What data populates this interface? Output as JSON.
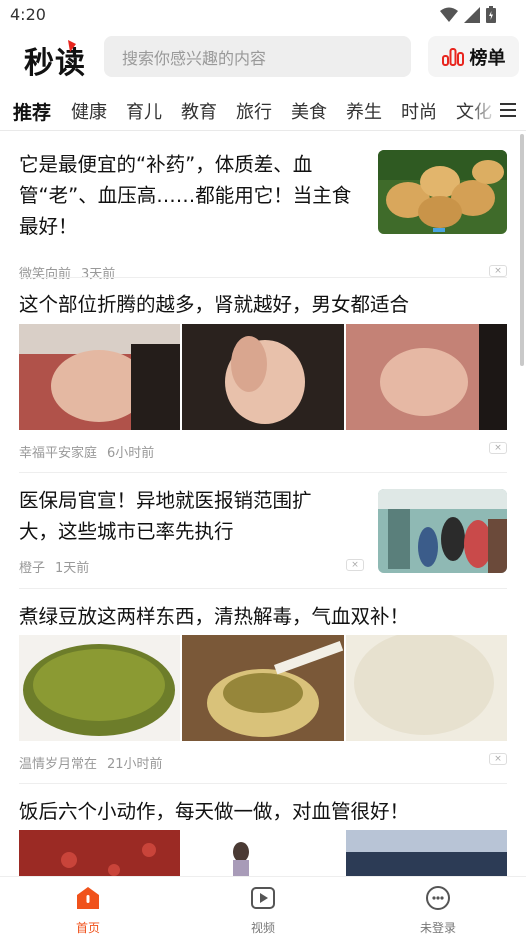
{
  "status": {
    "time": "4:20"
  },
  "header": {
    "logo_a": "秒",
    "logo_b": "读",
    "search_placeholder": "搜索你感兴趣的内容",
    "rank_label": "榜单"
  },
  "tabs": [
    "推荐",
    "健康",
    "育儿",
    "教育",
    "旅行",
    "美食",
    "养生",
    "时尚",
    "文化"
  ],
  "articles": [
    {
      "title": "它是最便宜的“补药”，体质差、血管“老”、血压高……都能用它！当主食最好！",
      "source": "微笑向前",
      "time": "3天前"
    },
    {
      "title": "这个部位折腾的越多，肾就越好，男女都适合",
      "source": "幸福平安家庭",
      "time": "6小时前"
    },
    {
      "title": "医保局官宣！异地就医报销范围扩大，这些城市已率先执行",
      "source": "橙子",
      "time": "1天前"
    },
    {
      "title": "煮绿豆放这两样东西，清热解毒，气血双补！",
      "source": "温情岁月常在",
      "time": "21小时前"
    },
    {
      "title": "饭后六个小动作，每天做一做，对血管很好！",
      "source": "",
      "time": ""
    }
  ],
  "bottom_nav": [
    {
      "label": "首页",
      "icon": "home-icon",
      "active": true
    },
    {
      "label": "视频",
      "icon": "video-icon",
      "active": false
    },
    {
      "label": "未登录",
      "icon": "profile-icon",
      "active": false
    }
  ],
  "colors": {
    "accent": "#f0521b",
    "logo_red": "#e8261f"
  }
}
